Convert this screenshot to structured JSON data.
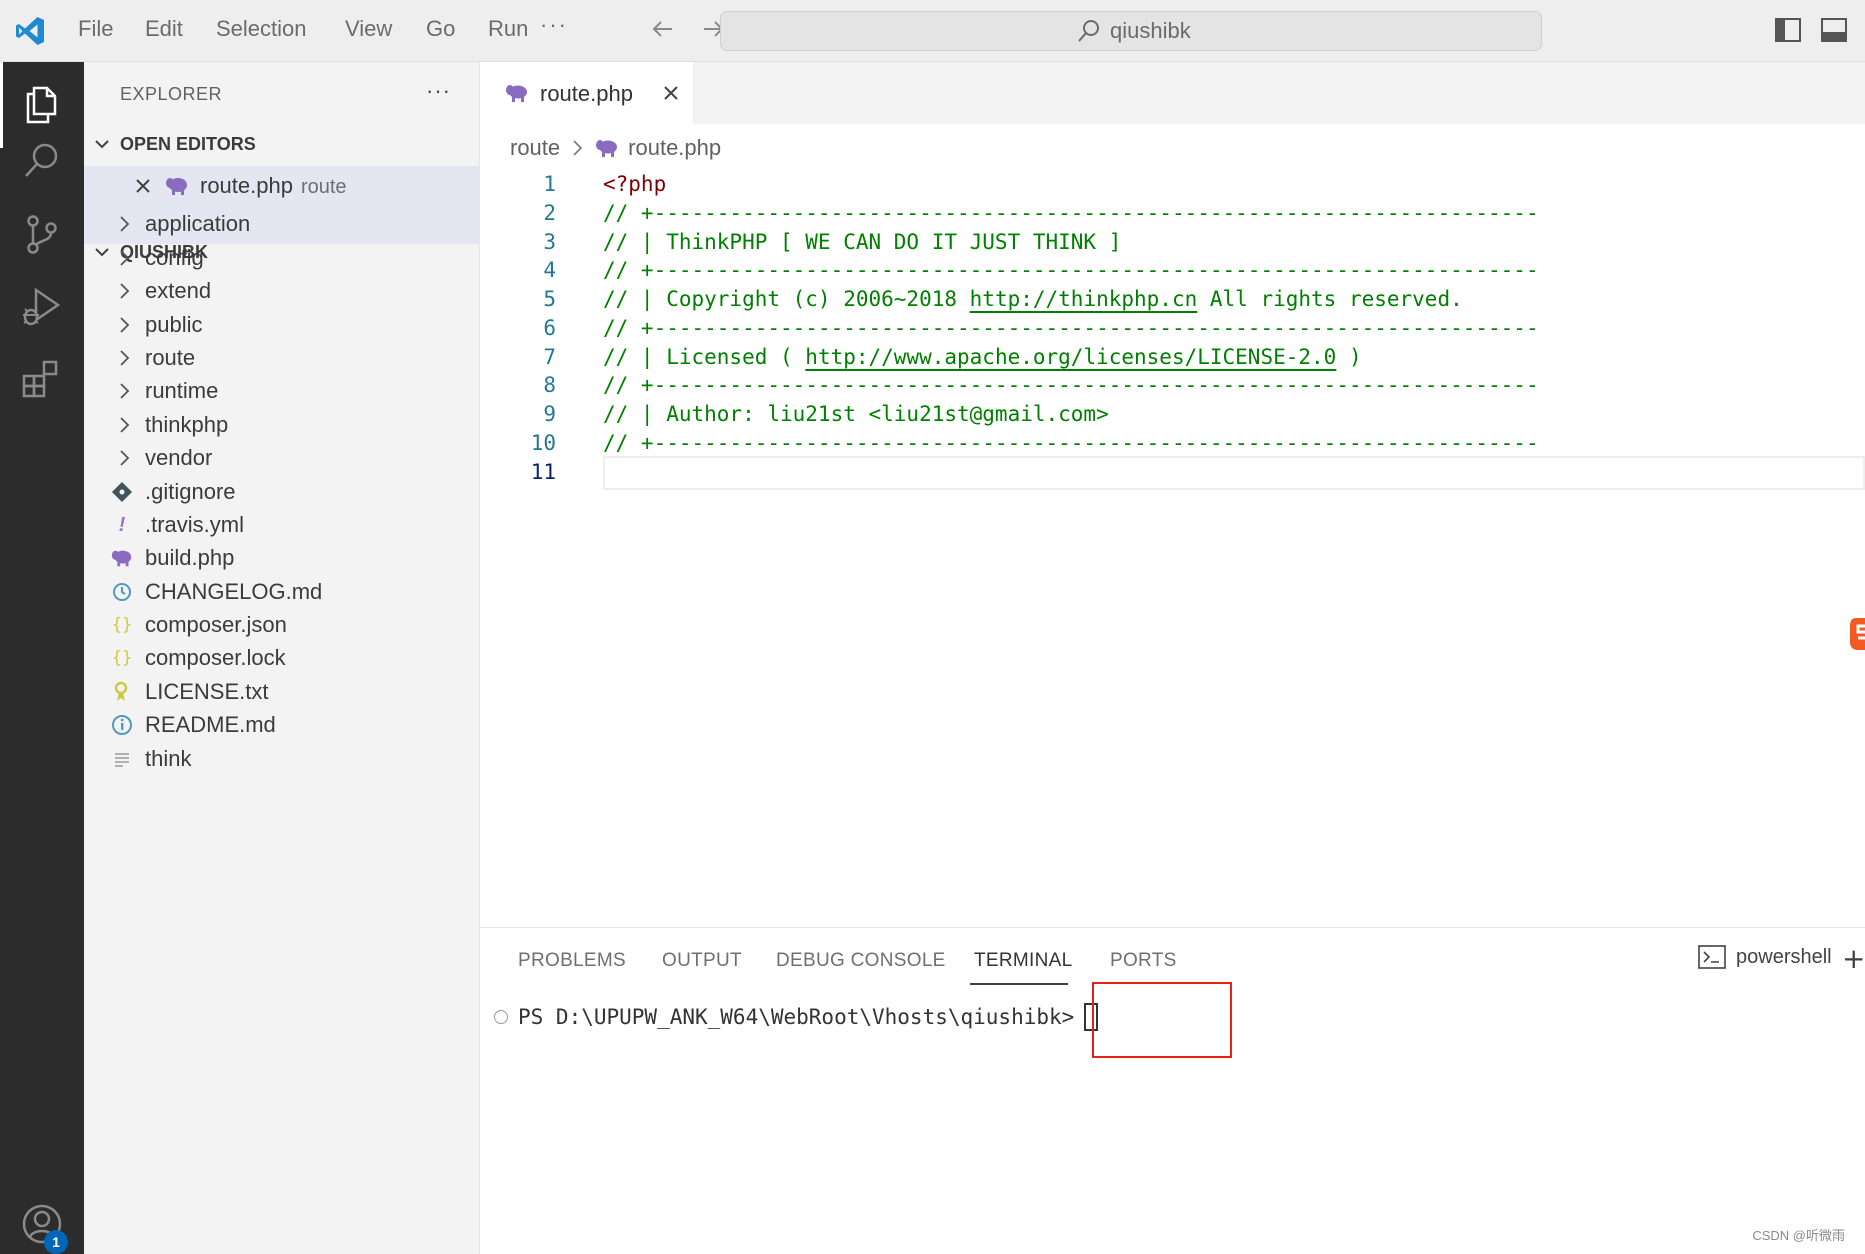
{
  "titlebar": {
    "menu": [
      "File",
      "Edit",
      "Selection",
      "View",
      "Go",
      "Run"
    ],
    "more": "···",
    "search_text": "qiushibk"
  },
  "activity_bar": {
    "icons": [
      "explorer-icon",
      "search-icon",
      "source-control-icon",
      "run-debug-icon",
      "extensions-icon",
      "accounts-icon"
    ],
    "accounts_badge": "1"
  },
  "sidebar": {
    "title": "EXPLORER",
    "more": "···",
    "open_editors": {
      "header": "OPEN EDITORS",
      "items": [
        {
          "label": "route.php",
          "description": "route"
        }
      ]
    },
    "project": {
      "header": "QIUSHIBK",
      "folders": [
        "application",
        "config",
        "extend",
        "public",
        "route",
        "runtime",
        "thinkphp",
        "vendor"
      ],
      "files": [
        {
          "label": ".gitignore",
          "icon": "git-icon"
        },
        {
          "label": ".travis.yml",
          "icon": "yaml-icon"
        },
        {
          "label": "build.php",
          "icon": "php-icon"
        },
        {
          "label": "CHANGELOG.md",
          "icon": "changelog-icon"
        },
        {
          "label": "composer.json",
          "icon": "json-icon"
        },
        {
          "label": "composer.lock",
          "icon": "json-icon"
        },
        {
          "label": "LICENSE.txt",
          "icon": "license-icon"
        },
        {
          "label": "README.md",
          "icon": "info-icon"
        },
        {
          "label": "think",
          "icon": "text-file-icon"
        }
      ]
    }
  },
  "editor": {
    "tab_label": "route.php",
    "breadcrumb": {
      "folder": "route",
      "file": "route.php"
    },
    "lines": [
      {
        "n": "1",
        "text": "<?php",
        "kind": "php"
      },
      {
        "n": "2",
        "text": "// +----------------------------------------------------------------------",
        "kind": "comment"
      },
      {
        "n": "3",
        "text": "// | ThinkPHP [ WE CAN DO IT JUST THINK ]",
        "kind": "comment"
      },
      {
        "n": "4",
        "text": "// +----------------------------------------------------------------------",
        "kind": "comment"
      },
      {
        "n": "5",
        "pre": "// | Copyright (c) 2006~2018 ",
        "link": "http://thinkphp.cn",
        "post": " All rights reserved.",
        "kind": "comment"
      },
      {
        "n": "6",
        "text": "// +----------------------------------------------------------------------",
        "kind": "comment"
      },
      {
        "n": "7",
        "pre": "// | Licensed ( ",
        "link": "http://www.apache.org/licenses/LICENSE-2.0",
        "post": " )",
        "kind": "comment"
      },
      {
        "n": "8",
        "text": "// +----------------------------------------------------------------------",
        "kind": "comment"
      },
      {
        "n": "9",
        "text": "// | Author: liu21st <liu21st@gmail.com>",
        "kind": "comment"
      },
      {
        "n": "10",
        "text": "// +----------------------------------------------------------------------",
        "kind": "comment"
      },
      {
        "n": "11",
        "text": "",
        "kind": "current"
      }
    ]
  },
  "panel": {
    "tabs": [
      "PROBLEMS",
      "OUTPUT",
      "DEBUG CONSOLE",
      "TERMINAL",
      "PORTS"
    ],
    "active_tab": "TERMINAL",
    "shell": "powershell",
    "new_terminal": "+",
    "prompt": "PS D:\\UPUPW_ANK_W64\\WebRoot\\Vhosts\\qiushibk>"
  },
  "watermark": "CSDN @听微雨",
  "colors": {
    "activity_bar": "#2c2c2c",
    "sidebar": "#f3f3f3",
    "selection": "#e4e6f1",
    "comment": "#008000",
    "php_tag": "#800000",
    "line_number": "#237893",
    "highlight_box": "#e5221a",
    "vscode_blue": "#0066b8"
  }
}
